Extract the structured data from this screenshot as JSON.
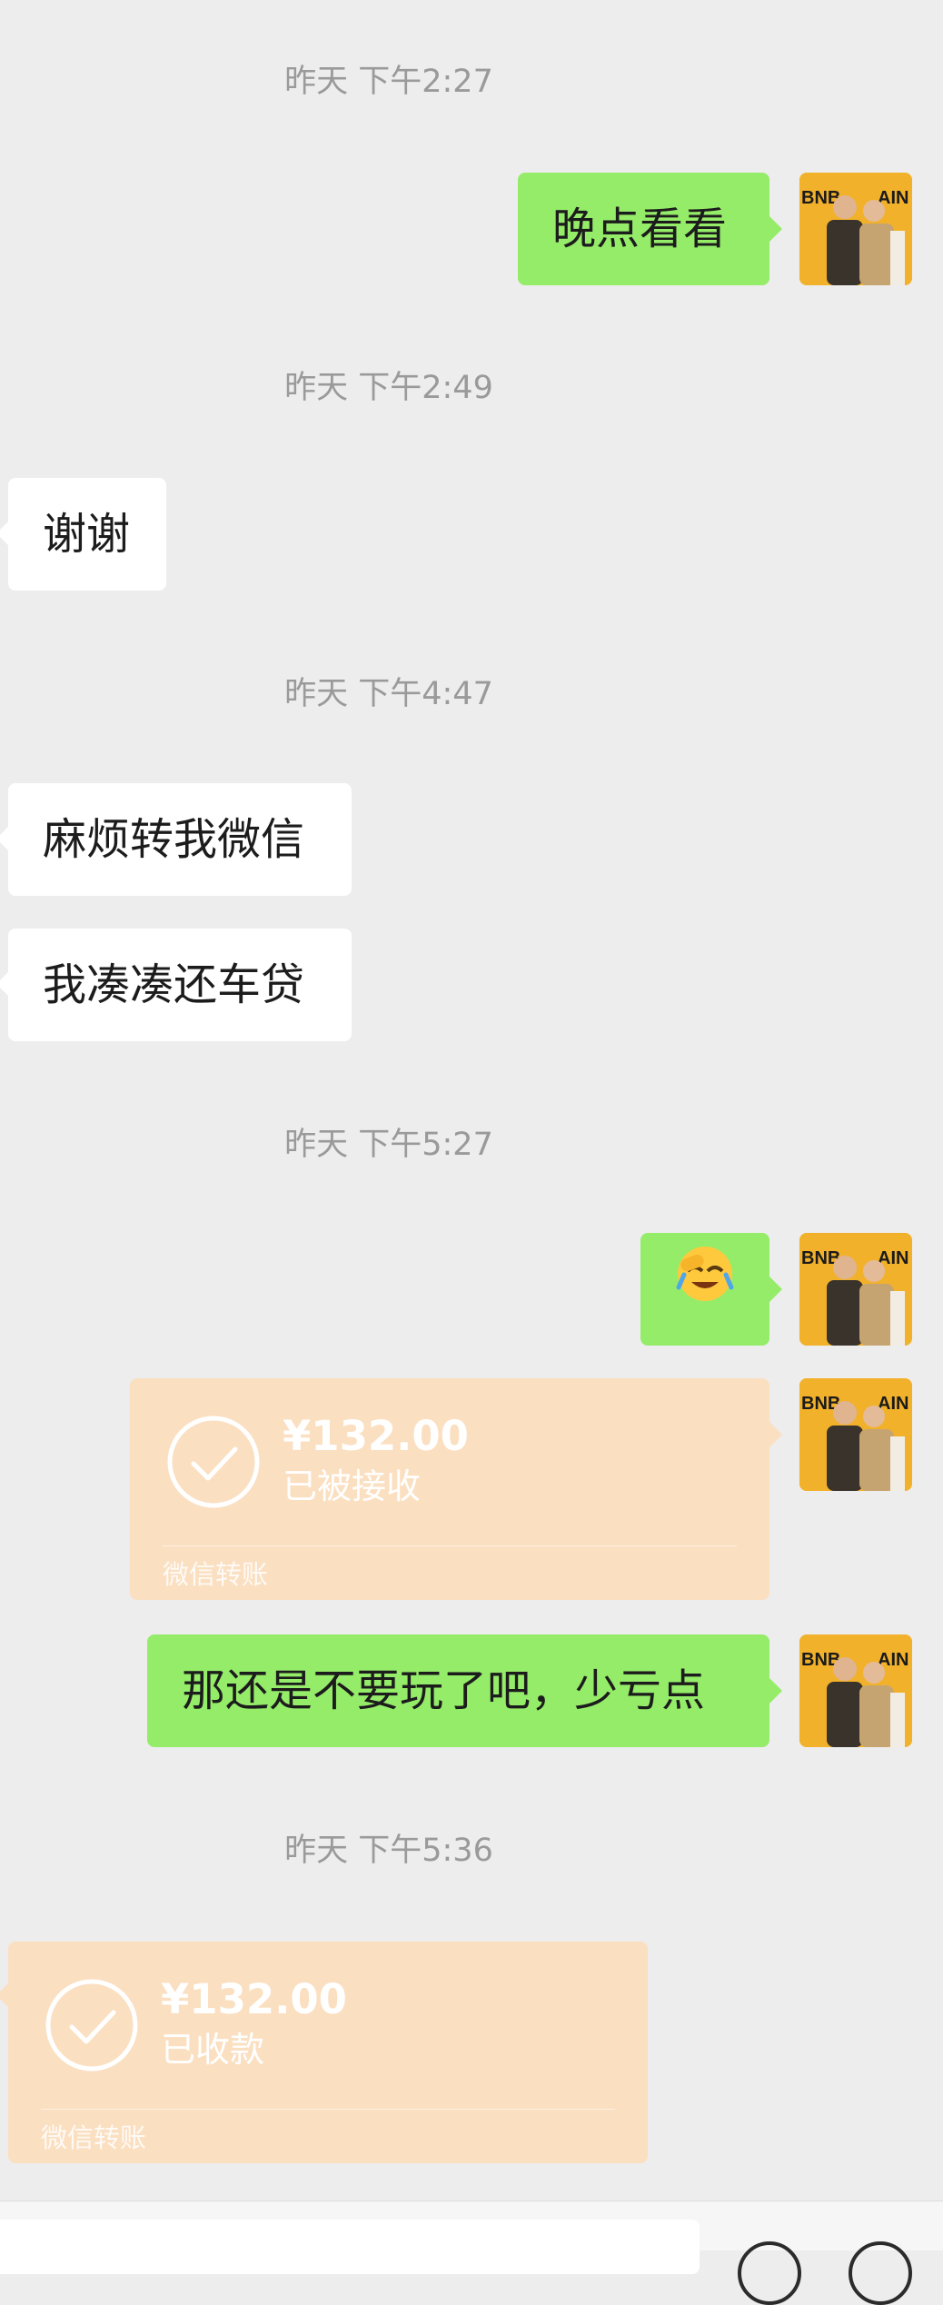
{
  "messages": {
    "t1": "昨天 下午2:27",
    "m1": "晚点看看",
    "t2": "昨天 下午2:49",
    "m2": "谢谢",
    "t3": "昨天 下午4:47",
    "m3": "麻烦转我微信",
    "m4": "我凑凑还车贷",
    "t4": "昨天 下午5:27",
    "m5_emoji": "🤦",
    "transfer1": {
      "amount": "¥132.00",
      "status": "已被接收",
      "label": "微信转账"
    },
    "m6": "那还是不要玩了吧，少亏点",
    "t5": "昨天 下午5:36",
    "transfer2": {
      "amount": "¥132.00",
      "status": "已收款",
      "label": "微信转账"
    }
  },
  "avatar": {
    "logo_text": "BNB CHAIN",
    "background": "#f2b12a"
  },
  "colors": {
    "background": "#ededed",
    "sent_bubble": "#95ec69",
    "received_bubble": "#ffffff",
    "transfer_card": "#fbdfc1",
    "timestamp": "#9a9a9a"
  },
  "icons": {
    "transfer_check": "check-circle-icon",
    "voice": "voice-icon",
    "emoji": "emoji-icon"
  }
}
